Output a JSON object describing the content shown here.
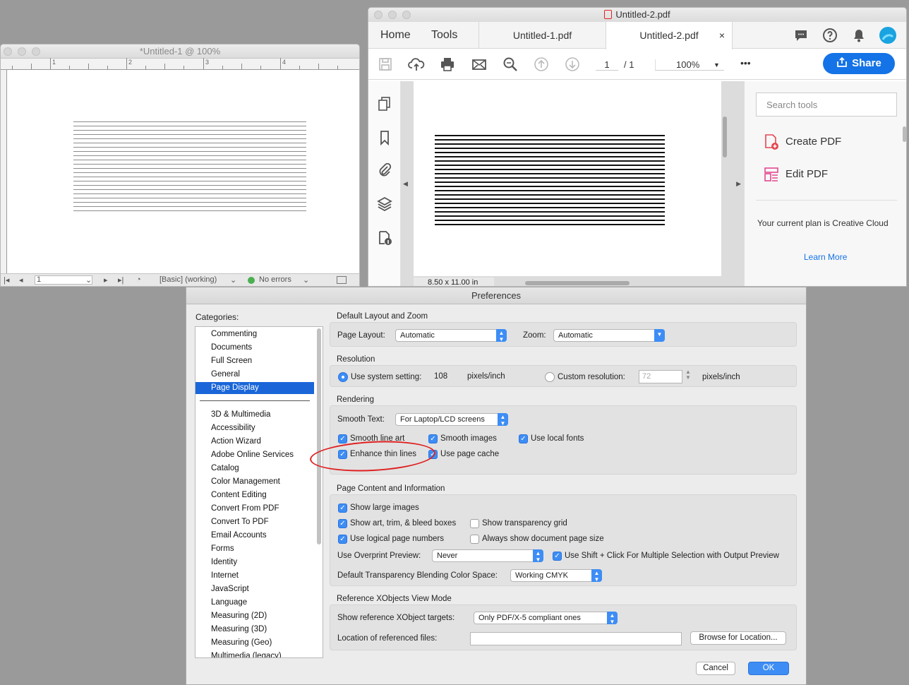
{
  "indesign": {
    "title": "*Untitled-1 @ 100%",
    "ruler_numbers": [
      "1",
      "2",
      "3",
      "4"
    ],
    "status": {
      "page": "1",
      "preflight_profile": "[Basic] (working)",
      "errors": "No errors"
    }
  },
  "acrobat": {
    "title": "Untitled-2.pdf",
    "nav": {
      "home": "Home",
      "tools": "Tools"
    },
    "tabs": [
      {
        "label": "Untitled-1.pdf"
      },
      {
        "label": "Untitled-2.pdf",
        "close": "×"
      }
    ],
    "toolbar": {
      "page_current": "1",
      "page_total": "/ 1",
      "zoom": "100%",
      "more": "•••",
      "share": "Share"
    },
    "page_size": "8.50 x 11.00 in",
    "tools_panel": {
      "search_placeholder": "Search tools",
      "items": [
        {
          "label": "Create PDF",
          "icon": "create-pdf-icon"
        },
        {
          "label": "Edit PDF",
          "icon": "edit-pdf-icon"
        }
      ],
      "plan_text": "Your current plan is Creative Cloud",
      "learn_more": "Learn More"
    }
  },
  "prefs": {
    "title": "Preferences",
    "categories_label": "Categories:",
    "categories_top": [
      "Commenting",
      "Documents",
      "Full Screen",
      "General",
      "Page Display"
    ],
    "selected": "Page Display",
    "categories_rest": [
      "3D & Multimedia",
      "Accessibility",
      "Action Wizard",
      "Adobe Online Services",
      "Catalog",
      "Color Management",
      "Content Editing",
      "Convert From PDF",
      "Convert To PDF",
      "Email Accounts",
      "Forms",
      "Identity",
      "Internet",
      "JavaScript",
      "Language",
      "Measuring (2D)",
      "Measuring (3D)",
      "Measuring (Geo)",
      "Multimedia (legacy)"
    ],
    "layout": {
      "section": "Default Layout and Zoom",
      "page_layout_label": "Page Layout:",
      "page_layout_value": "Automatic",
      "zoom_label": "Zoom:",
      "zoom_value": "Automatic"
    },
    "resolution": {
      "section": "Resolution",
      "system_label": "Use system setting:",
      "system_value": "108",
      "unit": "pixels/inch",
      "custom_label": "Custom resolution:",
      "custom_value": "72",
      "custom_unit": "pixels/inch"
    },
    "rendering": {
      "section": "Rendering",
      "smooth_text_label": "Smooth Text:",
      "smooth_text_value": "For Laptop/LCD screens",
      "smooth_line_art": "Smooth line art",
      "smooth_images": "Smooth images",
      "use_local_fonts": "Use local fonts",
      "enhance_thin_lines": "Enhance thin lines",
      "use_page_cache": "Use page cache"
    },
    "content": {
      "section": "Page Content and Information",
      "show_large_images": "Show large images",
      "show_art_trim": "Show art, trim, & bleed boxes",
      "show_transparency_grid": "Show transparency grid",
      "use_logical_page_numbers": "Use logical page numbers",
      "always_show_page_size": "Always show document page size",
      "overprint_label": "Use Overprint Preview:",
      "overprint_value": "Never",
      "shift_click": "Use Shift + Click For Multiple Selection with Output Preview",
      "blending_label": "Default Transparency Blending Color Space:",
      "blending_value": "Working CMYK"
    },
    "xobjects": {
      "section": "Reference XObjects View Mode",
      "targets_label": "Show reference XObject targets:",
      "targets_value": "Only PDF/X-5 compliant ones",
      "location_label": "Location of referenced files:",
      "location_value": "",
      "browse": "Browse for Location..."
    },
    "cancel": "Cancel",
    "ok": "OK"
  },
  "colors": {
    "accent": "#1473e6",
    "checkbox": "#3d8df5",
    "selection": "#1a66d8",
    "annotation": "#e02020"
  }
}
